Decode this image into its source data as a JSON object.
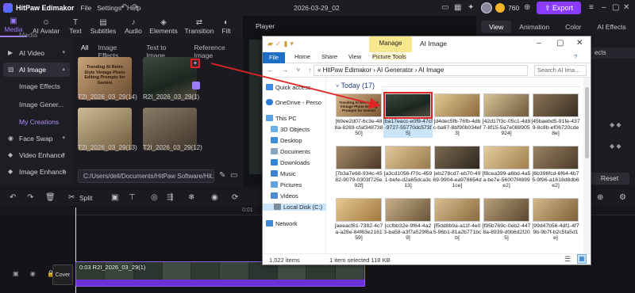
{
  "app": {
    "name": "HitPaw Edimakor",
    "menus": [
      "File",
      "Settings",
      "Help"
    ],
    "project_title": "2026-03-29_02",
    "credits": "760",
    "export_label": "Export"
  },
  "media_tabs": [
    {
      "label": "Media",
      "icon": "media-icon"
    },
    {
      "label": "AI Avatar",
      "icon": "ai-avatar-icon"
    },
    {
      "label": "Text",
      "icon": "text-icon"
    },
    {
      "label": "Subtitles",
      "icon": "subtitles-icon"
    },
    {
      "label": "Audio",
      "icon": "audio-icon"
    },
    {
      "label": "Elements",
      "icon": "elements-icon"
    },
    {
      "label": "Transition",
      "icon": "transition-icon"
    },
    {
      "label": "Filt",
      "icon": "filter-icon"
    }
  ],
  "sidebar": {
    "top_partial": "Media",
    "items": [
      {
        "label": "AI Video"
      },
      {
        "label": "AI Image"
      },
      {
        "label": "Image Effects"
      },
      {
        "label": "Image Gener..."
      },
      {
        "label": "My Creations"
      },
      {
        "label": "Face Swap"
      },
      {
        "label": "Video Enhance"
      },
      {
        "label": "Image Enhance"
      }
    ]
  },
  "media_panel": {
    "subtabs": [
      "All",
      "Image Effects",
      "Text to Image",
      "Reference Image"
    ],
    "items": [
      {
        "label": "T2I_2026_03_29(14)",
        "overlay": "Trending AI Retro Style Vintage Photo Editing Prompts for Gemini"
      },
      {
        "label": "R2I_2026_03_29(1)"
      },
      {
        "label": "T2I_2026_03_29(13)"
      },
      {
        "label": "T2I_2026_03_29(12)"
      }
    ],
    "path": "C:/Users/dell/Documents/HitPaw Software/Hit..."
  },
  "player": {
    "title": "Player"
  },
  "right_panel": {
    "tabs": [
      "View",
      "Animation",
      "Color",
      "AI Effects"
    ],
    "partial_label": "ects",
    "reset_label": "Reset"
  },
  "timeline": {
    "split_label": "Split",
    "ruler_label": "0:01",
    "cover_label": "Cover",
    "clip_label": "0:03  R2I_2026_03_29(1)"
  },
  "explorer": {
    "manage_label": "Manage",
    "window_title": "AI Image",
    "ribbon": [
      "File",
      "Home",
      "Share",
      "View",
      "Picture Tools"
    ],
    "address": "«  HitPaw Edimakor  ›  AI Generator  ›  AI Image",
    "search_placeholder": "Search AI Ima...",
    "nav": [
      "Quick access",
      "OneDrive - Perso",
      "This PC",
      "3D Objects",
      "Desktop",
      "Documents",
      "Downloads",
      "Music",
      "Pictures",
      "Videos",
      "Local Disk (C:)",
      "Network"
    ],
    "group_header": "Today (17)",
    "files": [
      "[69ee2d07-6c3e-488a-8269-cfaf34873850]",
      "[ba17eacc-e0f9-47cf-9727-55770dc573f5]",
      "[d4dec5fb-76fb-4dbc-ba67-8bf90b034ef3]",
      "[42d17f3c-05c1-4d87-8f15-5a7e088905924]",
      "[45baebd5-91fe-4379-8c8b-ef06720cde8e]",
      "[7b3a7e68-934c-4582-9079-0303f725e92f]",
      "[a3cd1056-f70c-4591-befe-d2a65dca3c13]",
      "[eb278cd7-eb70-4969-9904-ea978654d1ce]",
      "[f8cea399-a6bd-4a5a-be7e-56007f4899e2]",
      "[6b396fcd-6f64-4b75-9f96-a1618d8db6e2]",
      "[aeeacf61-7382-4c7a-a28e-84f63e216159]",
      "[ccfbb32e-9f64-4a23-ba58-a3f7a529f6a9]",
      "[f5dd8b9a-a11f-4e05-96b1-81a2b771bcb]",
      "[f95b769c-0eb2-4478a-8939-d0b6d2f205]",
      "[99d47b56-4df1-4f79b-9b7f-b2c5fa5d1e]"
    ],
    "status_count": "1,022 items",
    "status_selected": "1 item selected  118 KB"
  },
  "colors": {
    "accent": "#9d7bff",
    "export": "#8b3dff",
    "annotation": "#e02424",
    "selection": "#cce4f7"
  }
}
